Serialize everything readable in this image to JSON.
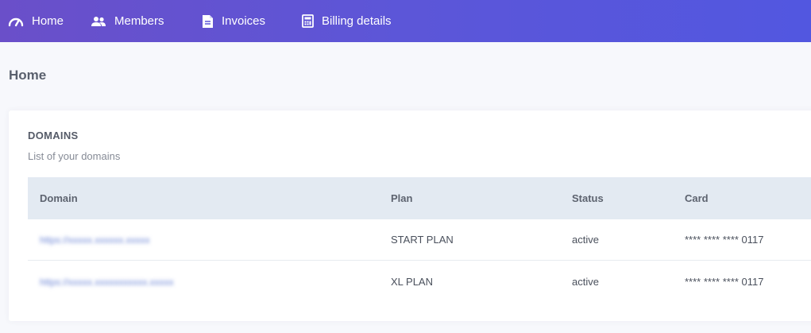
{
  "nav": {
    "items": [
      {
        "label": "Home",
        "icon": "gauge-icon"
      },
      {
        "label": "Members",
        "icon": "users-icon"
      },
      {
        "label": "Invoices",
        "icon": "document-icon"
      },
      {
        "label": "Billing details",
        "icon": "calculator-icon"
      }
    ]
  },
  "page": {
    "title": "Home"
  },
  "domains": {
    "title": "DOMAINS",
    "subtitle": "List of your domains",
    "columns": [
      "Domain",
      "Plan",
      "Status",
      "Card"
    ],
    "rows": [
      {
        "domain": "https://xxxxx.xxxxxx.xxxxx",
        "plan": "START PLAN",
        "status": "active",
        "card": "**** **** **** 0117"
      },
      {
        "domain": "https://xxxxx.xxxxxxxxxxx.xxxxx",
        "plan": "XL PLAN",
        "status": "active",
        "card": "**** **** **** 0117"
      }
    ]
  },
  "colors": {
    "nav_gradient_start": "#6a4fc9",
    "nav_gradient_end": "#5257e0",
    "table_header_bg": "#e3eaf2",
    "page_bg": "#f7f8fc"
  }
}
